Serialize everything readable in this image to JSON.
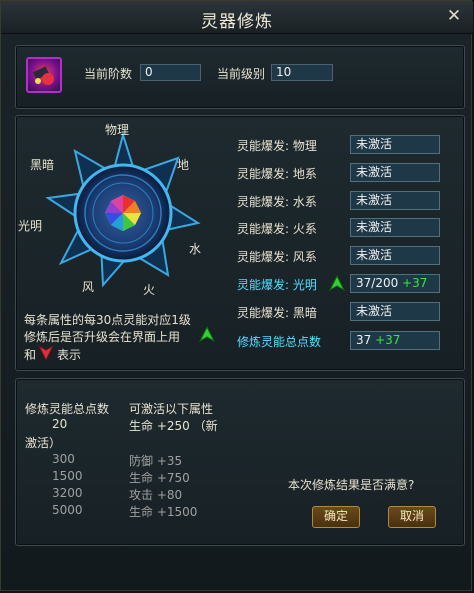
{
  "window": {
    "title": "灵器修炼",
    "close_symbol": "✕"
  },
  "header": {
    "item_icon": "artifact-icon",
    "stage_label": "当前阶数",
    "stage_value": "0",
    "level_label": "当前级别",
    "level_value": "10"
  },
  "wheel": {
    "labels": {
      "physical": "物理",
      "earth": "地",
      "water": "水",
      "fire": "火",
      "wind": "风",
      "light": "光明",
      "dark": "黑暗"
    }
  },
  "note": {
    "line1": "每条属性的每30点灵能对应1级",
    "line2": "修炼后是否升级会在界面上用",
    "line3_suffix": "表示"
  },
  "attributes": [
    {
      "label": "灵能爆发: 物理",
      "value": "未激活",
      "highlight": false
    },
    {
      "label": "灵能爆发: 地系",
      "value": "未激活",
      "highlight": false
    },
    {
      "label": "灵能爆发: 水系",
      "value": "未激活",
      "highlight": false
    },
    {
      "label": "灵能爆发: 火系",
      "value": "未激活",
      "highlight": false
    },
    {
      "label": "灵能爆发: 风系",
      "value": "未激活",
      "highlight": false
    },
    {
      "label": "灵能爆发: 光明",
      "value": "37/200",
      "bonus": "+37",
      "highlight": true
    },
    {
      "label": "灵能爆发: 黑暗",
      "value": "未激活",
      "highlight": false
    }
  ],
  "total": {
    "label": "修炼灵能总点数",
    "value": "37",
    "bonus": "+37"
  },
  "thresholds": {
    "header_points": "修炼灵能总点数",
    "header_attr": "可激活以下属性",
    "first_points": "20",
    "first_attr": "生命 +250 （新",
    "first_attr_cont": "激活）",
    "rows": [
      {
        "points": "300",
        "attr": "防御 +35"
      },
      {
        "points": "1500",
        "attr": "生命 +750"
      },
      {
        "points": "3200",
        "attr": "攻击 +80"
      },
      {
        "points": "5000",
        "attr": "生命 +1500"
      }
    ]
  },
  "confirm": {
    "question": "本次修炼结果是否满意?",
    "ok": "确定",
    "cancel": "取消"
  },
  "colors": {
    "accent_cyan": "#4fe0ff",
    "bonus_green": "#38e838",
    "gold_button": "#b08840"
  }
}
